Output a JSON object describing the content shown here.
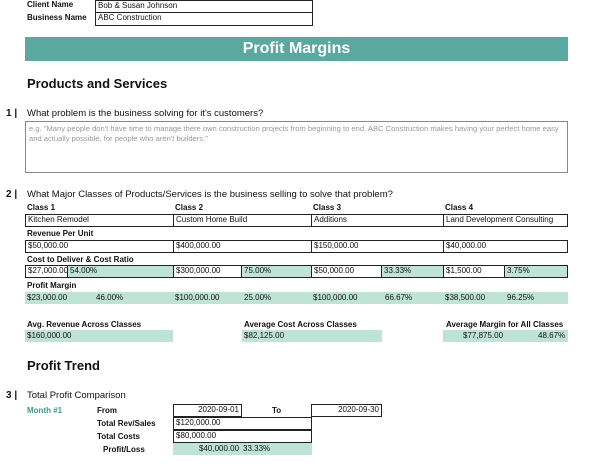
{
  "client": {
    "name_label": "Client Name",
    "name_value": "Bob & Susan Johnson",
    "business_label": "Business Name",
    "business_value": "ABC Construction"
  },
  "banner_title": "Profit Margins",
  "section_products": "Products and Services",
  "q1": {
    "number": "1 |",
    "question": "What problem is the business solving for it's customers?",
    "placeholder": "e.g. \"Many people don't have time to manage there own construction projects from beginning to end. ABC Construction makes having your perfect home easy and actually possible, for people who aren't builders.\""
  },
  "q2": {
    "number": "2 |",
    "question": "What Major Classes of Products/Services is the business selling to solve that problem?"
  },
  "classes": [
    {
      "header": "Class 1",
      "name": "Kitchen Remodel",
      "revenue": "$50,000.00",
      "cost": "$27,000.00",
      "cost_ratio": "54.00%",
      "margin": "$23,000.00",
      "margin_pct": "46.00%"
    },
    {
      "header": "Class 2",
      "name": "Custom Home Build",
      "revenue": "$400,000.00",
      "cost": "$300,000.00",
      "cost_ratio": "75.00%",
      "margin": "$100,000.00",
      "margin_pct": "25.00%"
    },
    {
      "header": "Class 3",
      "name": "Additions",
      "revenue": "$150,000.00",
      "cost": "$50,000.00",
      "cost_ratio": "33.33%",
      "margin": "$100,000.00",
      "margin_pct": "66.67%"
    },
    {
      "header": "Class 4",
      "name": "Land Development Consulting",
      "revenue": "$40,000.00",
      "cost": "$1,500.00",
      "cost_ratio": "3.75%",
      "margin": "$38,500.00",
      "margin_pct": "96.25%"
    }
  ],
  "labels": {
    "revenue_per_unit": "Revenue Per Unit",
    "cost_ratio": "Cost to Deliver & Cost Ratio",
    "profit_margin": "Profit Margin"
  },
  "averages": {
    "avg_revenue_label": "Avg. Revenue Across Classes",
    "avg_revenue": "$160,000.00",
    "avg_cost_label": "Average Cost Across Classes",
    "avg_cost": "$82,125.00",
    "avg_margin_label": "Average Margin for All Classes",
    "avg_margin": "$77,875.00",
    "avg_margin_pct": "48.67%"
  },
  "section_trend": "Profit Trend",
  "q3": {
    "number": "3 |",
    "title": "Total Profit Comparison"
  },
  "trend": {
    "month_label": "Month #1",
    "from_label": "From",
    "from_value": "2020-09-01",
    "to_label": "To",
    "to_value": "2020-09-30",
    "rev_label": "Total Rev/Sales",
    "rev_value": "$120,000.00",
    "costs_label": "Total Costs",
    "costs_value": "$80,000.00",
    "pl_label": "Profit/Loss",
    "pl_value": "$40,000.00",
    "pl_pct": "33.33%"
  },
  "colors": {
    "banner": "#5ba8a0",
    "highlight": "#bfe3d4",
    "month_label": "#3a9a8c"
  }
}
